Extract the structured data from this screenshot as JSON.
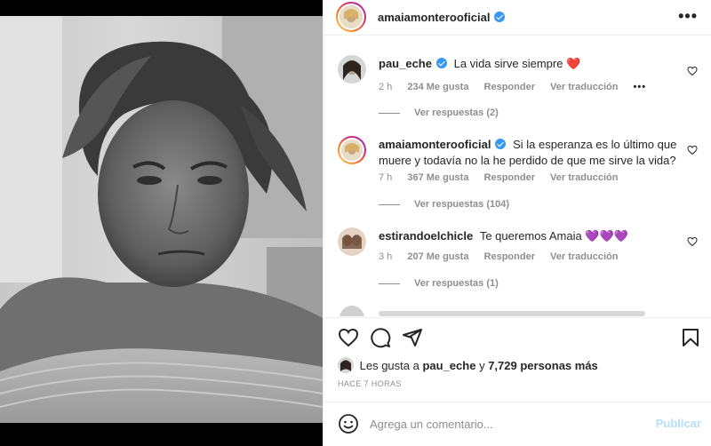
{
  "post": {
    "photo_alt": "black-and-white selfie photo"
  },
  "header": {
    "username": "amaiamonterooficial",
    "more_label": "•••"
  },
  "comments": [
    {
      "username": "pau_eche",
      "text": "La vida sirve siempre ❤️",
      "time": "2 h",
      "likes": "234 Me gusta",
      "reply": "Responder",
      "translate": "Ver traducción",
      "more": "•••",
      "replies": "Ver respuestas (2)"
    },
    {
      "username": "amaiamonterooficial",
      "text": "Si la esperanza es lo último que muere y todavía no la he perdido de que me sirve la vida?",
      "time": "7 h",
      "likes": "367 Me gusta",
      "reply": "Responder",
      "translate": "Ver traducción",
      "replies": "Ver respuestas (104)"
    },
    {
      "username": "estirandoelchicle",
      "text": "Te queremos Amaia 💜💜💜",
      "time": "3 h",
      "likes": "207 Me gusta",
      "reply": "Responder",
      "translate": "Ver traducción",
      "replies": "Ver respuestas (1)"
    }
  ],
  "likes": {
    "prefix": "Les gusta a",
    "user": "pau_eche",
    "connector": "y",
    "others": "7,729 personas más"
  },
  "timestamp": "HACE 7 HORAS",
  "add_comment": {
    "placeholder": "Agrega un comentario...",
    "publish": "Publicar"
  },
  "colors": {
    "verified": "#3897f0",
    "heart": "#ed4956",
    "publish_disabled": "#b2dffc"
  }
}
